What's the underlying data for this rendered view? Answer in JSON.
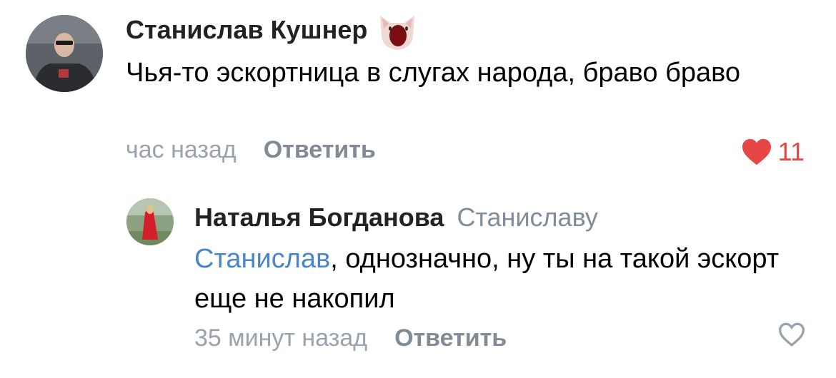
{
  "comments": [
    {
      "author": "Станислав Кушнер",
      "sticker": "screaming-cat-sticker",
      "text": "Чья-то эскортница в слугах народа, браво браво",
      "time": "час назад",
      "reply_label": "Ответить",
      "likes": "11",
      "liked": true
    },
    {
      "author": "Наталья Богданова",
      "reply_to": "Станиславу",
      "mention": "Станислав",
      "text": ", однозначно, ну ты на такой эскорт еще не накопил",
      "time": "35 минут назад",
      "reply_label": "Ответить",
      "liked": false
    }
  ],
  "colors": {
    "author": "#222222",
    "secondary": "#99a2ad",
    "action": "#828a96",
    "mention": "#4a85c7",
    "like": "#e64646"
  }
}
